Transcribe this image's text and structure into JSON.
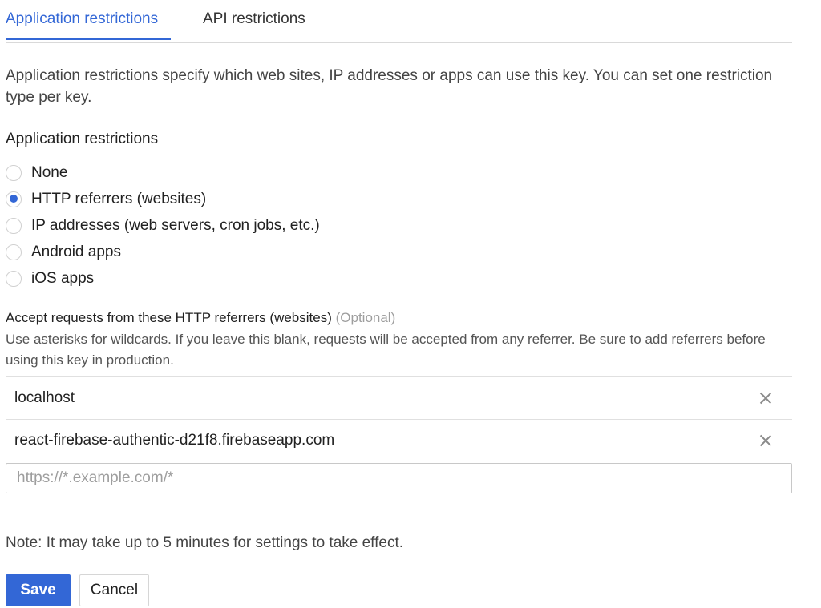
{
  "tabs": [
    {
      "label": "Application restrictions",
      "active": true
    },
    {
      "label": "API restrictions",
      "active": false
    }
  ],
  "description": "Application restrictions specify which web sites, IP addresses or apps can use this key. You can set one restriction type per key.",
  "restrictions": {
    "title": "Application restrictions",
    "options": [
      {
        "label": "None",
        "checked": false
      },
      {
        "label": "HTTP referrers (websites)",
        "checked": true
      },
      {
        "label": "IP addresses (web servers, cron jobs, etc.)",
        "checked": false
      },
      {
        "label": "Android apps",
        "checked": false
      },
      {
        "label": "iOS apps",
        "checked": false
      }
    ]
  },
  "referrers": {
    "title": "Accept requests from these HTTP referrers (websites)",
    "optional_label": "(Optional)",
    "help": "Use asterisks for wildcards. If you leave this blank, requests will be accepted from any referrer. Be sure to add referrers before using this key in production.",
    "items": [
      {
        "value": "localhost",
        "remove_icon": "close-icon"
      },
      {
        "value": "react-firebase-authentic-d21f8.firebaseapp.com",
        "remove_icon": "close-icon"
      }
    ],
    "input_value": "",
    "input_placeholder": "https://*.example.com/*"
  },
  "note": "Note: It may take up to 5 minutes for settings to take effect.",
  "actions": {
    "save_label": "Save",
    "cancel_label": "Cancel"
  },
  "colors": {
    "accent": "#3367d6"
  }
}
